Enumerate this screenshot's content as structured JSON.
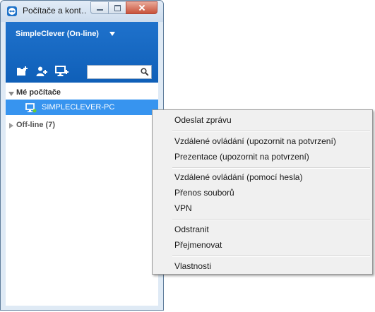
{
  "window": {
    "title": "Počítače a kont…",
    "account_label": "SimpleClever (On-line)"
  },
  "toolbar": {
    "add_group_icon": "folder-add-icon",
    "add_contact_icon": "person-add-icon",
    "add_computer_icon": "computer-add-icon",
    "search_value": "",
    "search_placeholder": ""
  },
  "tree": {
    "groups": [
      {
        "label": "Mé počítače",
        "expanded": true
      },
      {
        "label": "Off-line (7)",
        "expanded": false
      }
    ],
    "selected_computer": "SIMPLECLEVER-PC"
  },
  "context_menu": {
    "items": [
      "Odeslat zprávu",
      "Vzdálené ovládání (upozornit na potvrzení)",
      "Prezentace (upozornit na potvrzení)",
      "Vzdálené ovládání (pomocí hesla)",
      "Přenos souborů",
      "VPN",
      "Odstranit",
      "Přejmenovat",
      "Vlastnosti"
    ]
  },
  "colors": {
    "header_blue": "#1f72cc",
    "selection_blue": "#3794ef",
    "online_status": "#66cc33"
  }
}
